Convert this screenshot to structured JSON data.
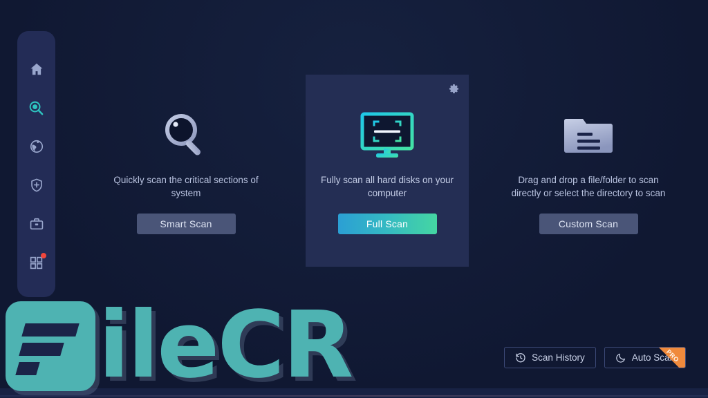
{
  "theme": {
    "background": "#121c38",
    "sidebar_bg": "#232c56",
    "card_bg": "#242e54",
    "accent_teal": "#3fd3c0",
    "accent_green": "#45d6a2",
    "accent_blue": "#2b9fd4",
    "muted_button": "#4a5578",
    "text_primary": "#dfe5f4",
    "text_muted": "#b9c3e0",
    "pro_orange": "#f08a3c",
    "badge_red": "#f0463c",
    "watermark_teal": "#4eb3b2"
  },
  "sidebar": {
    "items": [
      {
        "icon": "home-icon",
        "name": "sidebar-item-home",
        "active": false
      },
      {
        "icon": "search-icon",
        "name": "sidebar-item-scan",
        "active": true
      },
      {
        "icon": "globe-icon",
        "name": "sidebar-item-web-protection",
        "active": false
      },
      {
        "icon": "shield-plus-icon",
        "name": "sidebar-item-protection",
        "active": false
      },
      {
        "icon": "toolbox-icon",
        "name": "sidebar-item-tools",
        "active": false
      },
      {
        "icon": "grid-apps-icon",
        "name": "sidebar-item-more",
        "active": false,
        "badge": true
      }
    ]
  },
  "panels": [
    {
      "id": "smart-scan",
      "icon": "magnifier-icon",
      "description": "Quickly scan the critical sections of system",
      "button_label": "Smart Scan",
      "primary": false
    },
    {
      "id": "full-scan",
      "icon": "monitor-scan-icon",
      "description": "Fully scan all hard disks on your computer",
      "button_label": "Full Scan",
      "primary": true,
      "settings_icon": "gear-icon"
    },
    {
      "id": "custom-scan",
      "icon": "folder-icon",
      "description": "Drag and drop a file/folder to scan directly or select the directory to scan",
      "button_label": "Custom Scan",
      "primary": false
    }
  ],
  "bottom_actions": [
    {
      "id": "scan-history",
      "icon": "history-clock-icon",
      "label": "Scan History",
      "pro": false
    },
    {
      "id": "auto-scan",
      "icon": "moon-icon",
      "label": "Auto Scan",
      "pro": true,
      "pro_label": "PRO"
    }
  ],
  "watermark": {
    "text": "ileCR",
    "full_name": "FileCR"
  }
}
